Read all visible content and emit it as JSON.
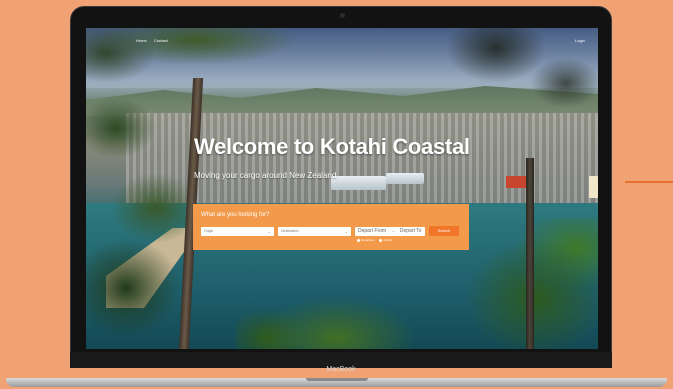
{
  "nav": {
    "links": [
      "Home",
      "Contact"
    ],
    "login_label": "Login"
  },
  "hero": {
    "title": "Welcome to Kotahi Coastal",
    "subtitle": "Moving your cargo around New Zealand"
  },
  "search": {
    "heading": "What are you looking for?",
    "origin_placeholder": "Origin",
    "destination_placeholder": "Destination",
    "depart_from": "Depart From",
    "arrow": "→",
    "depart_to": "Depart To",
    "button_label": "Search",
    "radio_options": [
      "Departure",
      "Arrival"
    ]
  },
  "device": {
    "brand": "MacBook"
  },
  "colors": {
    "accent": "#f39a4a",
    "button": "#f2762a",
    "background": "#f0a274"
  }
}
